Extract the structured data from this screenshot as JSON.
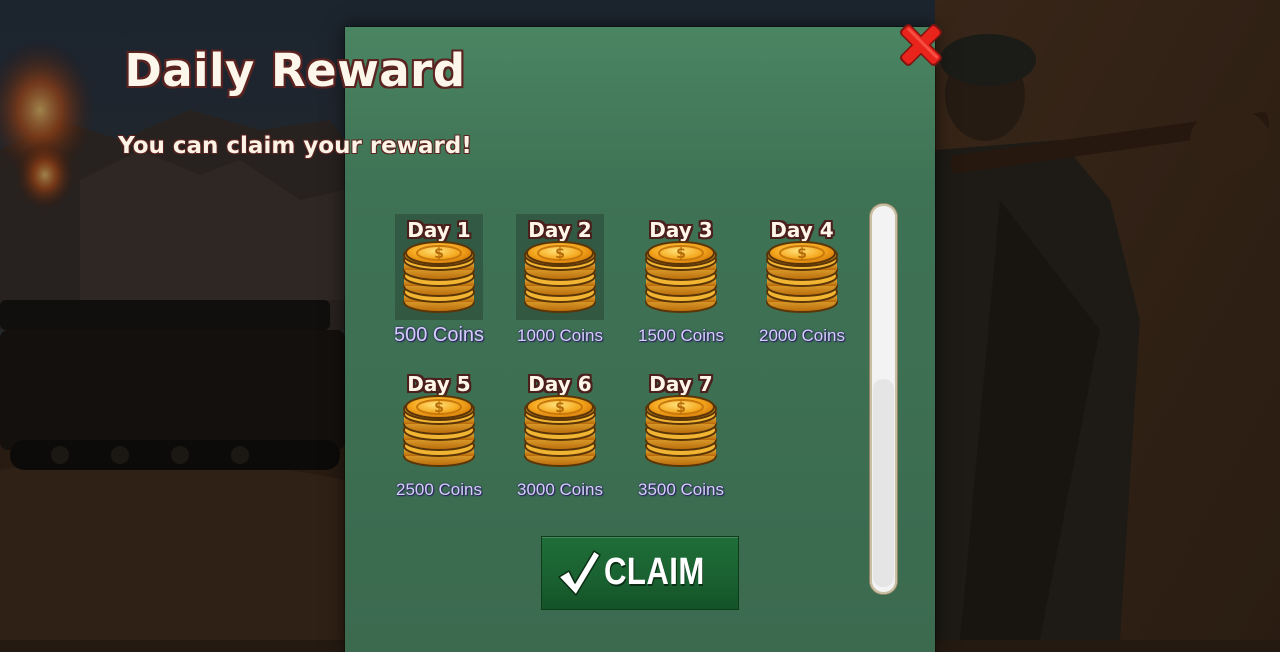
{
  "dialog": {
    "title": "Daily Reward",
    "subtitle": "You can claim your reward!",
    "close_icon": "red-x-close-icon",
    "claim_label": "CLAIM",
    "claim_icon": "checkmark-icon"
  },
  "rewards": [
    {
      "day": "Day 1",
      "amount": "500 Coins",
      "claimed": true
    },
    {
      "day": "Day 2",
      "amount": "1000 Coins",
      "claimed": true
    },
    {
      "day": "Day 3",
      "amount": "1500 Coins",
      "claimed": false
    },
    {
      "day": "Day 4",
      "amount": "2000 Coins",
      "claimed": false
    },
    {
      "day": "Day 5",
      "amount": "2500 Coins",
      "claimed": false
    },
    {
      "day": "Day 6",
      "amount": "3000 Coins",
      "claimed": false
    },
    {
      "day": "Day 7",
      "amount": "3500 Coins",
      "claimed": false
    }
  ],
  "icons": {
    "reward": "gold-coin-stack-icon"
  },
  "colors": {
    "dialog_bg": "#3f7355",
    "title_text": "#fdf6ea",
    "title_outline": "#5a2320",
    "amount_text": "#d5cdfa",
    "claim_button": "#1a6231",
    "close_x": "#e8201a"
  }
}
